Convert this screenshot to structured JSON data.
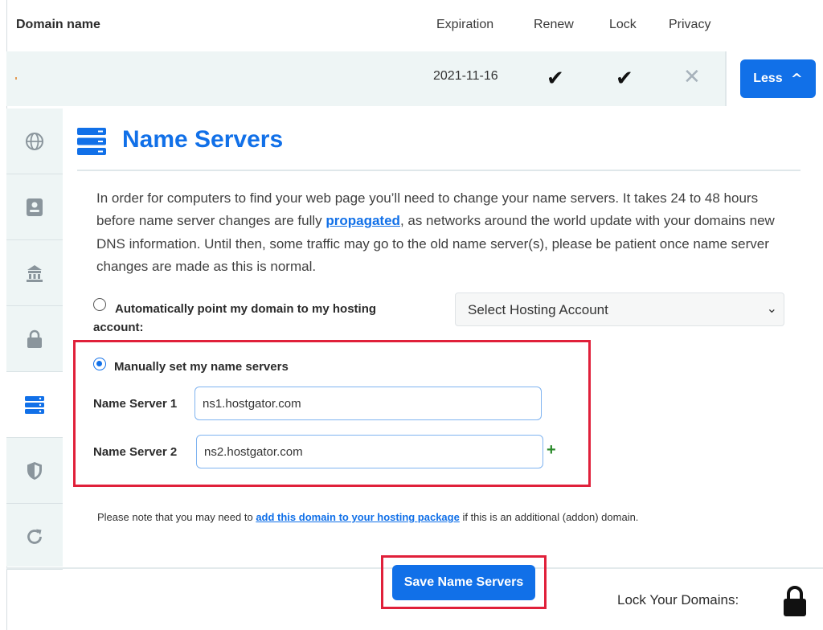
{
  "header": {
    "domain_name": "Domain name",
    "expiration": "Expiration",
    "renew": "Renew",
    "lock": "Lock",
    "privacy": "Privacy"
  },
  "domain_row": {
    "expiration_date": "2021-11-16",
    "renew_mark": "✔",
    "lock_mark": "✔",
    "privacy_mark": "✕",
    "less_button": "Less"
  },
  "sidebar": {
    "tabs": [
      {
        "icon": "globe-icon"
      },
      {
        "icon": "contact-card-icon"
      },
      {
        "icon": "building-icon"
      },
      {
        "icon": "lock-icon"
      },
      {
        "icon": "server-icon",
        "active": true
      },
      {
        "icon": "shield-icon"
      },
      {
        "icon": "refresh-icon"
      }
    ]
  },
  "name_servers": {
    "title": "Name Servers",
    "intro_part1": "In order for computers to find your web page you’ll need to change your name servers. It takes 24 to 48 hours before name server changes are fully ",
    "intro_link": "propagated",
    "intro_part2": ", as networks around the world update with your domains new DNS information. Until then, some traffic may go to the old name server(s), please be patient once name server changes are made as this is normal.",
    "auto_option_label": "Automatically point my domain to my hosting account:",
    "hosting_select_value": "Select Hosting Account",
    "manual_option_label": "Manually set my name servers",
    "ns1_label": "Name Server 1",
    "ns1_value": "ns1.hostgator.com",
    "ns2_label": "Name Server 2",
    "ns2_value": "ns2.hostgator.com",
    "add_symbol": "+",
    "note_part1": "Please note that you may need to ",
    "note_link": "add this domain to your hosting package",
    "note_part2": " if this is an additional (addon) domain.",
    "save_button": "Save Name Servers"
  },
  "footer": {
    "lock_domains_label": "Lock Your Domains:"
  },
  "colors": {
    "accent": "#1170e8",
    "highlight": "#e0203a",
    "row_bg": "#eef5f5"
  }
}
